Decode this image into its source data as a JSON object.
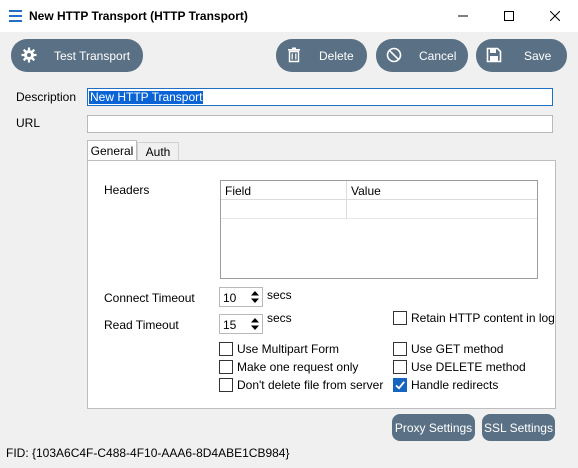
{
  "window": {
    "title": "New HTTP Transport (HTTP Transport)",
    "app_icon": "menu-lines-icon"
  },
  "toolbar": {
    "test_label": "Test Transport",
    "delete_label": "Delete",
    "cancel_label": "Cancel",
    "save_label": "Save"
  },
  "form": {
    "description_label": "Description",
    "description_value": "New HTTP Transport",
    "url_label": "URL",
    "url_value": ""
  },
  "tabs": {
    "general": "General",
    "auth": "Auth"
  },
  "general": {
    "headers_label": "Headers",
    "headers_columns": [
      "Field",
      "Value"
    ],
    "connect_timeout_label": "Connect Timeout",
    "connect_timeout_value": "10",
    "connect_timeout_unit": "secs",
    "read_timeout_label": "Read Timeout",
    "read_timeout_value": "15",
    "read_timeout_unit": "secs",
    "retain_label": "Retain HTTP content in log",
    "multipart_label": "Use Multipart Form",
    "one_request_label": "Make one request only",
    "dont_delete_label": "Don't delete file from server",
    "use_get_label": "Use GET method",
    "use_delete_label": "Use DELETE method",
    "handle_redirects_label": "Handle redirects",
    "handle_redirects_checked": true
  },
  "footer": {
    "proxy_label": "Proxy Settings",
    "ssl_label": "SSL Settings",
    "fid": "FID: {103A6C4F-C488-4F10-AAA6-8D4ABE1CB984}"
  }
}
